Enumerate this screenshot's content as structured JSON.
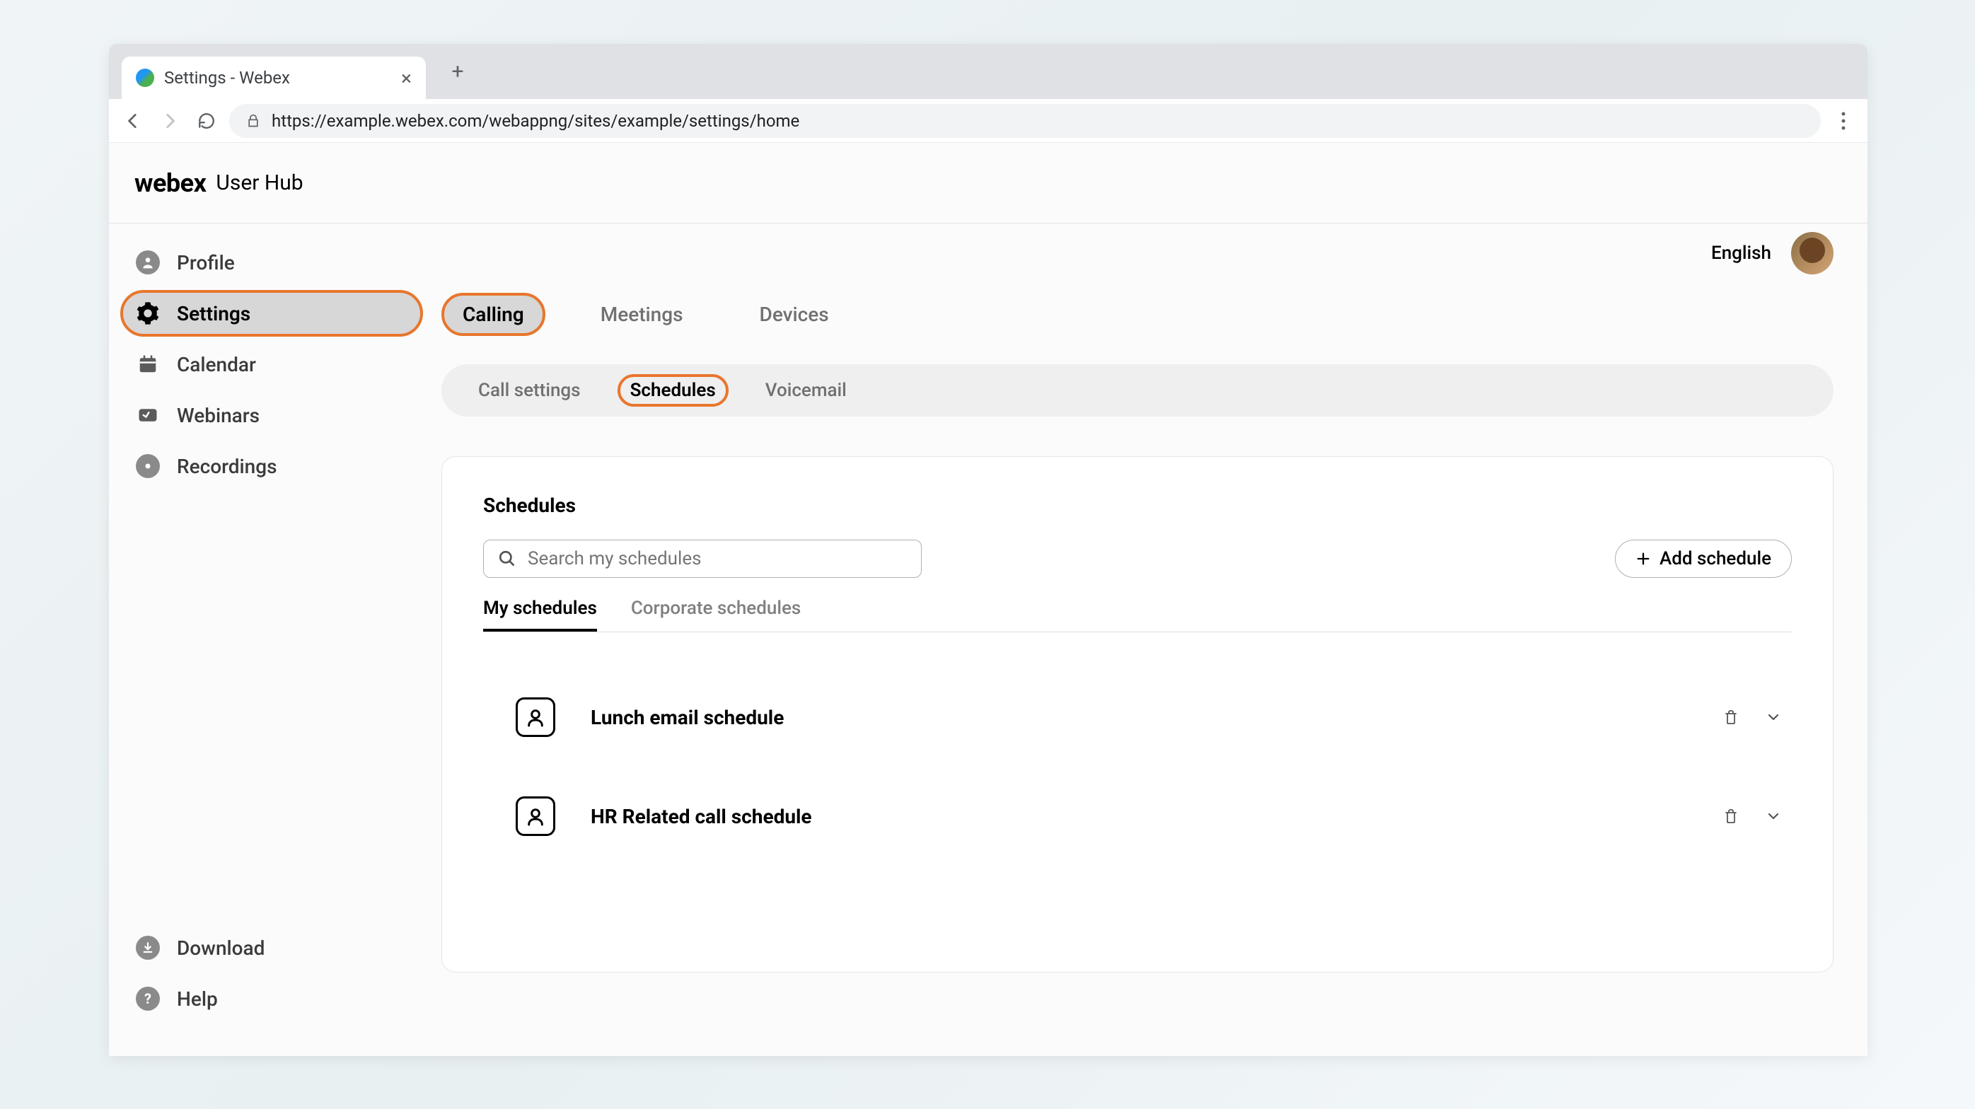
{
  "browser": {
    "tab_title": "Settings - Webex",
    "url": "https://example.webex.com/webappng/sites/example/settings/home"
  },
  "brand": {
    "logo": "webex",
    "sub": "User Hub"
  },
  "topright": {
    "language": "English"
  },
  "sidebar": {
    "items": [
      {
        "label": "Profile",
        "icon": "person"
      },
      {
        "label": "Settings",
        "icon": "gear"
      },
      {
        "label": "Calendar",
        "icon": "calendar"
      },
      {
        "label": "Webinars",
        "icon": "webinar"
      },
      {
        "label": "Recordings",
        "icon": "record"
      }
    ],
    "bottom": [
      {
        "label": "Download",
        "icon": "download"
      },
      {
        "label": "Help",
        "icon": "help"
      }
    ]
  },
  "primary_tabs": [
    {
      "label": "Calling"
    },
    {
      "label": "Meetings"
    },
    {
      "label": "Devices"
    }
  ],
  "sub_tabs": [
    {
      "label": "Call settings"
    },
    {
      "label": "Schedules"
    },
    {
      "label": "Voicemail"
    }
  ],
  "card": {
    "title": "Schedules",
    "search_placeholder": "Search my schedules",
    "add_button": "Add schedule"
  },
  "schedule_tabs": [
    {
      "label": "My schedules"
    },
    {
      "label": "Corporate schedules"
    }
  ],
  "schedules": [
    {
      "name": "Lunch email schedule"
    },
    {
      "name": "HR Related call schedule"
    }
  ]
}
